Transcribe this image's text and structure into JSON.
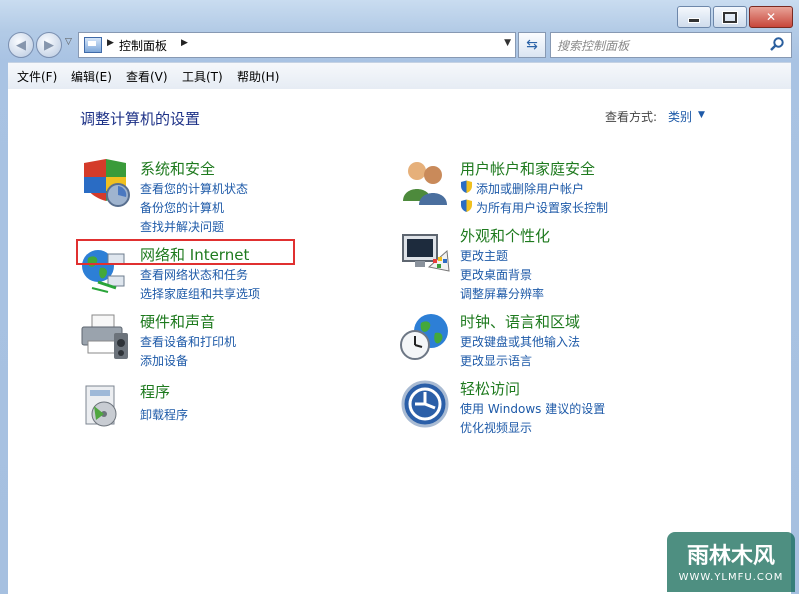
{
  "address": {
    "breadcrumb": "控制面板",
    "search_placeholder": "搜索控制面板"
  },
  "menu": [
    "文件(F)",
    "编辑(E)",
    "查看(V)",
    "工具(T)",
    "帮助(H)"
  ],
  "main": {
    "title": "调整计算机的设置",
    "view_by_label": "查看方式:",
    "view_by_value": "类别"
  },
  "categories": [
    {
      "title": "系统和安全",
      "icon": "shield-icon",
      "links": [
        "查看您的计算机状态",
        "备份您的计算机",
        "查找并解决问题"
      ]
    },
    {
      "title": "网络和 Internet",
      "icon": "network-globe-icon",
      "links": [
        "查看网络状态和任务",
        "选择家庭组和共享选项"
      ]
    },
    {
      "title": "硬件和声音",
      "icon": "printer-icon",
      "links": [
        "查看设备和打印机",
        "添加设备"
      ]
    },
    {
      "title": "程序",
      "icon": "programs-icon",
      "links": [
        "卸载程序"
      ]
    },
    {
      "title": "用户帐户和家庭安全",
      "icon": "users-icon",
      "links": [
        "添加或删除用户帐户",
        "为所有用户设置家长控制"
      ]
    },
    {
      "title": "外观和个性化",
      "icon": "monitor-palette-icon",
      "links": [
        "更改主题",
        "更改桌面背景",
        "调整屏幕分辨率"
      ]
    },
    {
      "title": "时钟、语言和区域",
      "icon": "clock-globe-icon",
      "links": [
        "更改键盘或其他输入法",
        "更改显示语言"
      ]
    },
    {
      "title": "轻松访问",
      "icon": "ease-of-access-icon",
      "links": [
        "使用 Windows 建议的设置",
        "优化视频显示"
      ]
    }
  ],
  "watermark": {
    "big": "雨林木风",
    "small": "WWW.YLMFU.COM"
  },
  "colors": {
    "category_title": "#1e7a1e",
    "link": "#1e5aa8",
    "page_title": "#1e3287",
    "highlight": "#e03030"
  }
}
